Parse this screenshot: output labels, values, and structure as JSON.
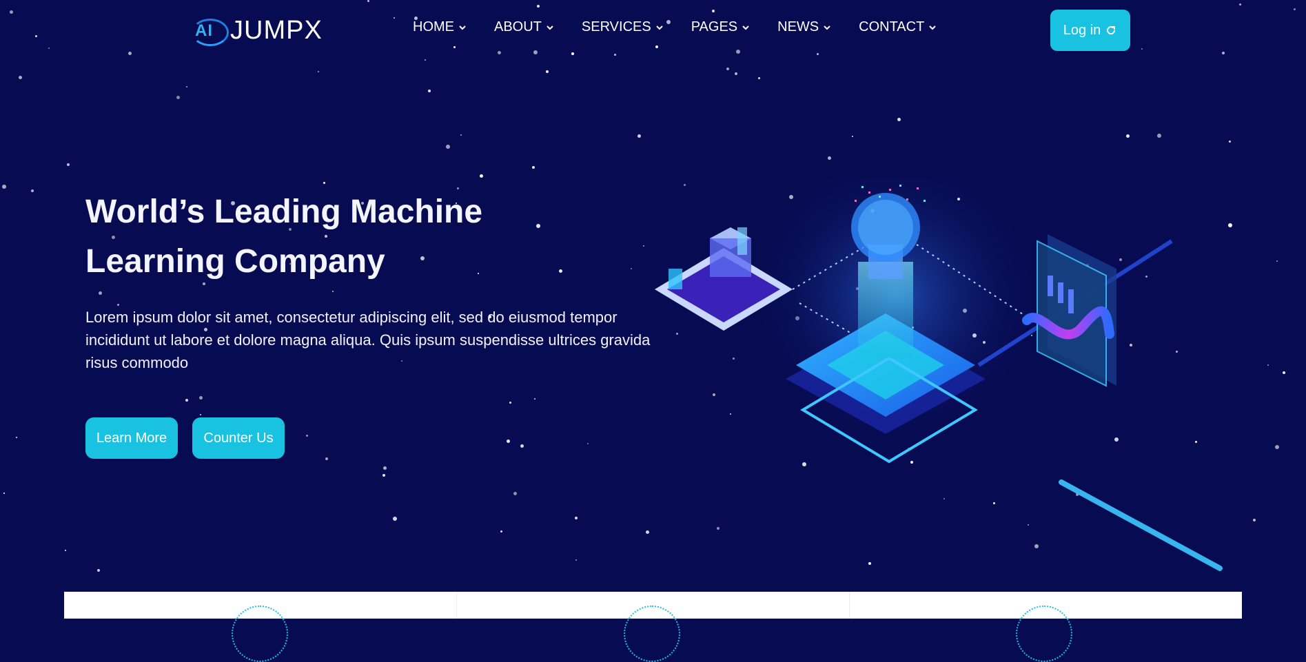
{
  "brand": {
    "logo_mark": "AI",
    "name": "JUMPX"
  },
  "nav": {
    "items": [
      {
        "label": "HOME"
      },
      {
        "label": "ABOUT"
      },
      {
        "label": "SERVICES"
      },
      {
        "label": "PAGES"
      },
      {
        "label": "NEWS"
      },
      {
        "label": "CONTACT"
      }
    ],
    "login_label": "Log in"
  },
  "hero": {
    "title_line1": "World’s Leading Machine",
    "title_line2": "Learning Company",
    "description": "Lorem ipsum dolor sit amet, consectetur adipiscing elit, sed do eiusmod tempor incididunt ut labore et dolore magna aliqua. Quis ipsum suspendisse ultrices gravida risus commodo",
    "primary_button": "Learn More",
    "secondary_button": "Counter Us"
  },
  "colors": {
    "background": "#070b52",
    "accent": "#18c2e0",
    "text": "#ffffff"
  },
  "icons": [
    "chevron-down-icon",
    "refresh-icon",
    "star-icon",
    "ai-illustration"
  ]
}
